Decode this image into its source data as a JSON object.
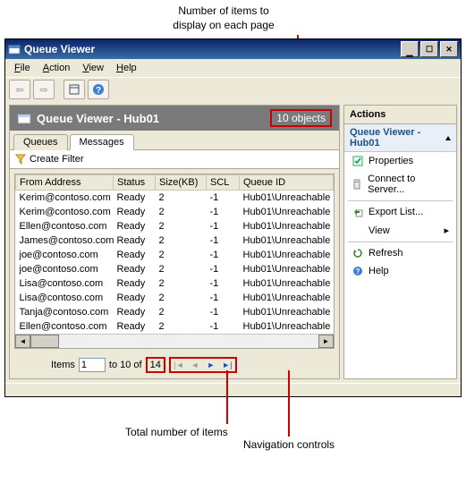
{
  "annotations": {
    "top": "Number of items to\ndisplay on each page",
    "bottom_left": "Total number of items",
    "bottom_right": "Navigation controls"
  },
  "window": {
    "title": "Queue Viewer",
    "buttons": {
      "min": "_",
      "max": "❐",
      "close": "✕"
    }
  },
  "menu": {
    "file": "File",
    "action": "Action",
    "view": "View",
    "help": "Help"
  },
  "header": {
    "title": "Queue Viewer - Hub01",
    "object_count": "10 objects"
  },
  "tabs": {
    "queues": "Queues",
    "messages": "Messages"
  },
  "filter": {
    "label": "Create Filter"
  },
  "columns": {
    "from": "From Address",
    "status": "Status",
    "size": "Size(KB)",
    "scl": "SCL",
    "qid": "Queue ID"
  },
  "rows": [
    {
      "from": "Kerim@contoso.com",
      "status": "Ready",
      "size": "2",
      "scl": "-1",
      "qid": "Hub01\\Unreachable"
    },
    {
      "from": "Kerim@contoso.com",
      "status": "Ready",
      "size": "2",
      "scl": "-1",
      "qid": "Hub01\\Unreachable"
    },
    {
      "from": "Ellen@contoso.com",
      "status": "Ready",
      "size": "2",
      "scl": "-1",
      "qid": "Hub01\\Unreachable"
    },
    {
      "from": "James@contoso.com",
      "status": "Ready",
      "size": "2",
      "scl": "-1",
      "qid": "Hub01\\Unreachable"
    },
    {
      "from": "joe@contoso.com",
      "status": "Ready",
      "size": "2",
      "scl": "-1",
      "qid": "Hub01\\Unreachable"
    },
    {
      "from": "joe@contoso.com",
      "status": "Ready",
      "size": "2",
      "scl": "-1",
      "qid": "Hub01\\Unreachable"
    },
    {
      "from": "Lisa@contoso.com",
      "status": "Ready",
      "size": "2",
      "scl": "-1",
      "qid": "Hub01\\Unreachable"
    },
    {
      "from": "Lisa@contoso.com",
      "status": "Ready",
      "size": "2",
      "scl": "-1",
      "qid": "Hub01\\Unreachable"
    },
    {
      "from": "Tanja@contoso.com",
      "status": "Ready",
      "size": "2",
      "scl": "-1",
      "qid": "Hub01\\Unreachable"
    },
    {
      "from": "Ellen@contoso.com",
      "status": "Ready",
      "size": "2",
      "scl": "-1",
      "qid": "Hub01\\Unreachable"
    }
  ],
  "pager": {
    "items_label": "Items",
    "page_value": "1",
    "to_of": "to 10 of",
    "total": "14"
  },
  "actions": {
    "title": "Actions",
    "subtitle": "Queue Viewer - Hub01",
    "items": {
      "properties": "Properties",
      "connect": "Connect to Server...",
      "export": "Export List...",
      "view": "View",
      "refresh": "Refresh",
      "help": "Help"
    }
  }
}
